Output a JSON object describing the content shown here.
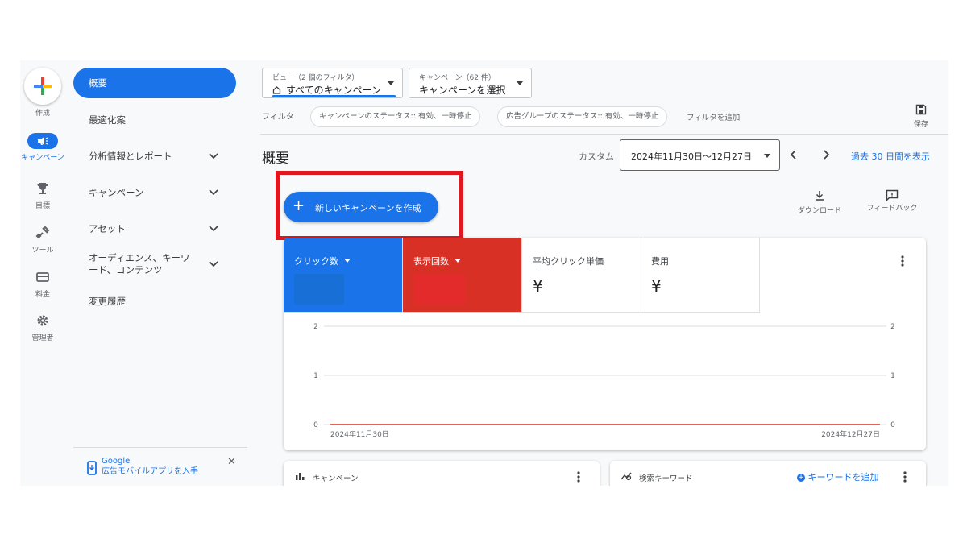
{
  "rail": {
    "create_label": "作成",
    "items": [
      {
        "label": "キャンペーン",
        "icon": "megaphone-icon",
        "active": true
      },
      {
        "label": "目標",
        "icon": "trophy-icon"
      },
      {
        "label": "ツール",
        "icon": "tools-icon"
      },
      {
        "label": "料金",
        "icon": "credit-card-icon"
      },
      {
        "label": "管理者",
        "icon": "gear-icon"
      }
    ]
  },
  "nav": {
    "items": [
      {
        "label": "概要",
        "active": true
      },
      {
        "label": "最適化案"
      },
      {
        "label": "分析情報とレポート",
        "expandable": true
      },
      {
        "label": "キャンペーン",
        "expandable": true
      },
      {
        "label": "アセット",
        "expandable": true
      },
      {
        "label": "オーディエンス、キーワード、コンテンツ",
        "expandable": true
      },
      {
        "label": "変更履歴"
      }
    ],
    "promo": {
      "title": "Google",
      "text": "広告モバイルアプリを入手"
    }
  },
  "view_selector": {
    "caption": "ビュー（2 個のフィルタ）",
    "value": "すべてのキャンペーン"
  },
  "campaign_selector": {
    "caption": "キャンペーン（62 件）",
    "value": "キャンペーンを選択"
  },
  "filters": {
    "label": "フィルタ",
    "chips": [
      "キャンペーンのステータス:: 有効、一時停止",
      "広告グループのステータス:: 有効、一時停止"
    ],
    "add": "フィルタを追加",
    "save": "保存"
  },
  "page": {
    "title": "概要",
    "date_label": "カスタム",
    "date_range": "2024年11月30日～12月27日",
    "past_30": "過去 30 日間を表示",
    "new_campaign": "新しいキャンペーンを作成",
    "download": "ダウンロード",
    "feedback": "フィードバック"
  },
  "metrics": [
    {
      "label": "クリック数",
      "color": "#1a73e8",
      "dropdown": true
    },
    {
      "label": "表示回数",
      "color": "#d93025",
      "dropdown": true
    },
    {
      "label": "平均クリック単価",
      "value": "¥"
    },
    {
      "label": "費用",
      "value": "¥"
    }
  ],
  "chart_data": {
    "type": "line",
    "x": [
      "2024年11月30日",
      "2024年12月27日"
    ],
    "series": [
      {
        "values": [
          0,
          0
        ],
        "color": "#d93025"
      }
    ],
    "ylim": [
      0,
      2
    ],
    "y_ticks": [
      "2",
      "1",
      "0"
    ],
    "grid": true
  },
  "bottom_cards": [
    {
      "title": "キャンペーン",
      "icon": "bar-chart-icon"
    },
    {
      "title": "検索キーワード",
      "icon": "keyword-trend-icon",
      "action": "キーワードを追加"
    }
  ]
}
